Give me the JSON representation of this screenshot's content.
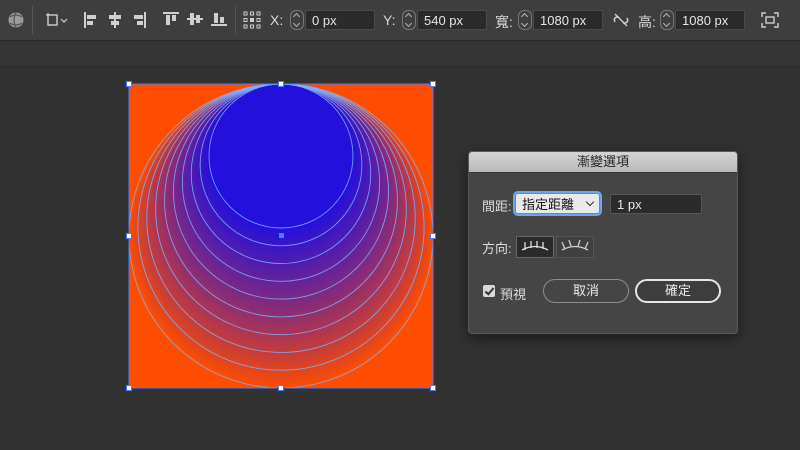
{
  "control_bar": {
    "x_label": "X:",
    "x_value": "0 px",
    "y_label": "Y:",
    "y_value": "540 px",
    "w_label": "寬:",
    "w_value": "1080 px",
    "h_label": "高:",
    "h_value": "1080 px",
    "icons": [
      "globe-icon",
      "transform-shape-icon",
      "align-left-icon",
      "align-hcenter-icon",
      "align-right-icon",
      "align-top-icon",
      "align-vcenter-icon",
      "align-bottom-icon",
      "reference-point-icon",
      "constrain-link-icon",
      "transform-icon"
    ]
  },
  "artwork": {
    "background_color": "#ff4d00",
    "gradient_start": "#2410dc",
    "gradient_end": "#ff4d00",
    "outline_color": "#7fb0ff",
    "blend_steps": 9
  },
  "dialog": {
    "title": "漸變選項",
    "spacing_label": "間距:",
    "spacing_option": "指定距離",
    "spacing_value": "1 px",
    "orientation_label": "方向:",
    "orientation_options": [
      "align-to-page-icon",
      "align-to-path-icon"
    ],
    "preview_label": "預視",
    "preview_checked": true,
    "cancel_label": "取消",
    "ok_label": "確定"
  }
}
